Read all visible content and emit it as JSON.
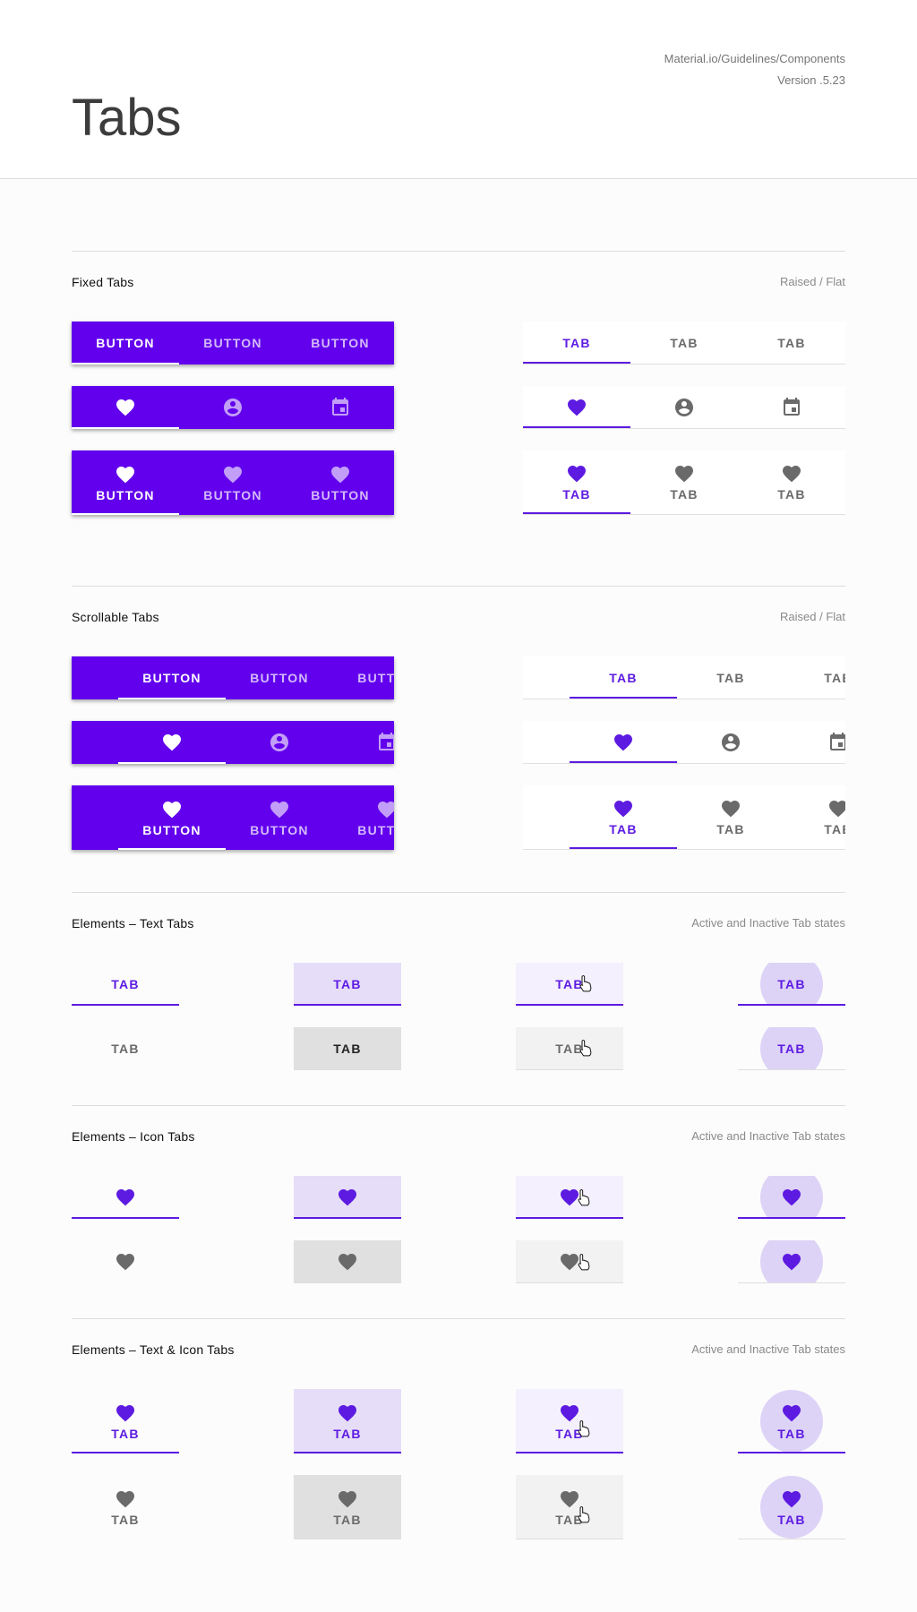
{
  "header": {
    "title": "Tabs",
    "source": "Material.io/Guidelines/Components",
    "version": "Version .5.23"
  },
  "colors": {
    "primary": "#6200ee",
    "active_tab": "#5d1be2",
    "inactive_tab": "#6a6a6a",
    "selected_bg": "#e6ddf9",
    "hover_bg": "#f4f0fd",
    "pressed_bg": "#e0e0e0"
  },
  "icons": {
    "primary": "heart-icon",
    "secondary": "account-circle-icon",
    "tertiary": "calendar-icon",
    "cursor": "hand-pointer-icon"
  },
  "fixed": {
    "title": "Fixed Tabs",
    "note": "Raised / Flat",
    "raised_labels": [
      "BUTTON",
      "BUTTON",
      "BUTTON"
    ],
    "flat_labels": [
      "TAB",
      "TAB",
      "TAB"
    ]
  },
  "scrollable": {
    "title": "Scrollable Tabs",
    "note": "Raised / Flat",
    "raised_labels": [
      "BUTTON",
      "BUTTON",
      "BUTTON"
    ],
    "flat_labels": [
      "TAB",
      "TAB",
      "TAB"
    ]
  },
  "text_tabs": {
    "title": "Elements – Text Tabs",
    "note": "Active and Inactive Tab states",
    "label": "TAB"
  },
  "icon_tabs": {
    "title": "Elements – Icon Tabs",
    "note": "Active and Inactive Tab states"
  },
  "text_icon_tabs": {
    "title": "Elements – Text & Icon Tabs",
    "note": "Active and Inactive Tab states",
    "label": "TAB"
  }
}
